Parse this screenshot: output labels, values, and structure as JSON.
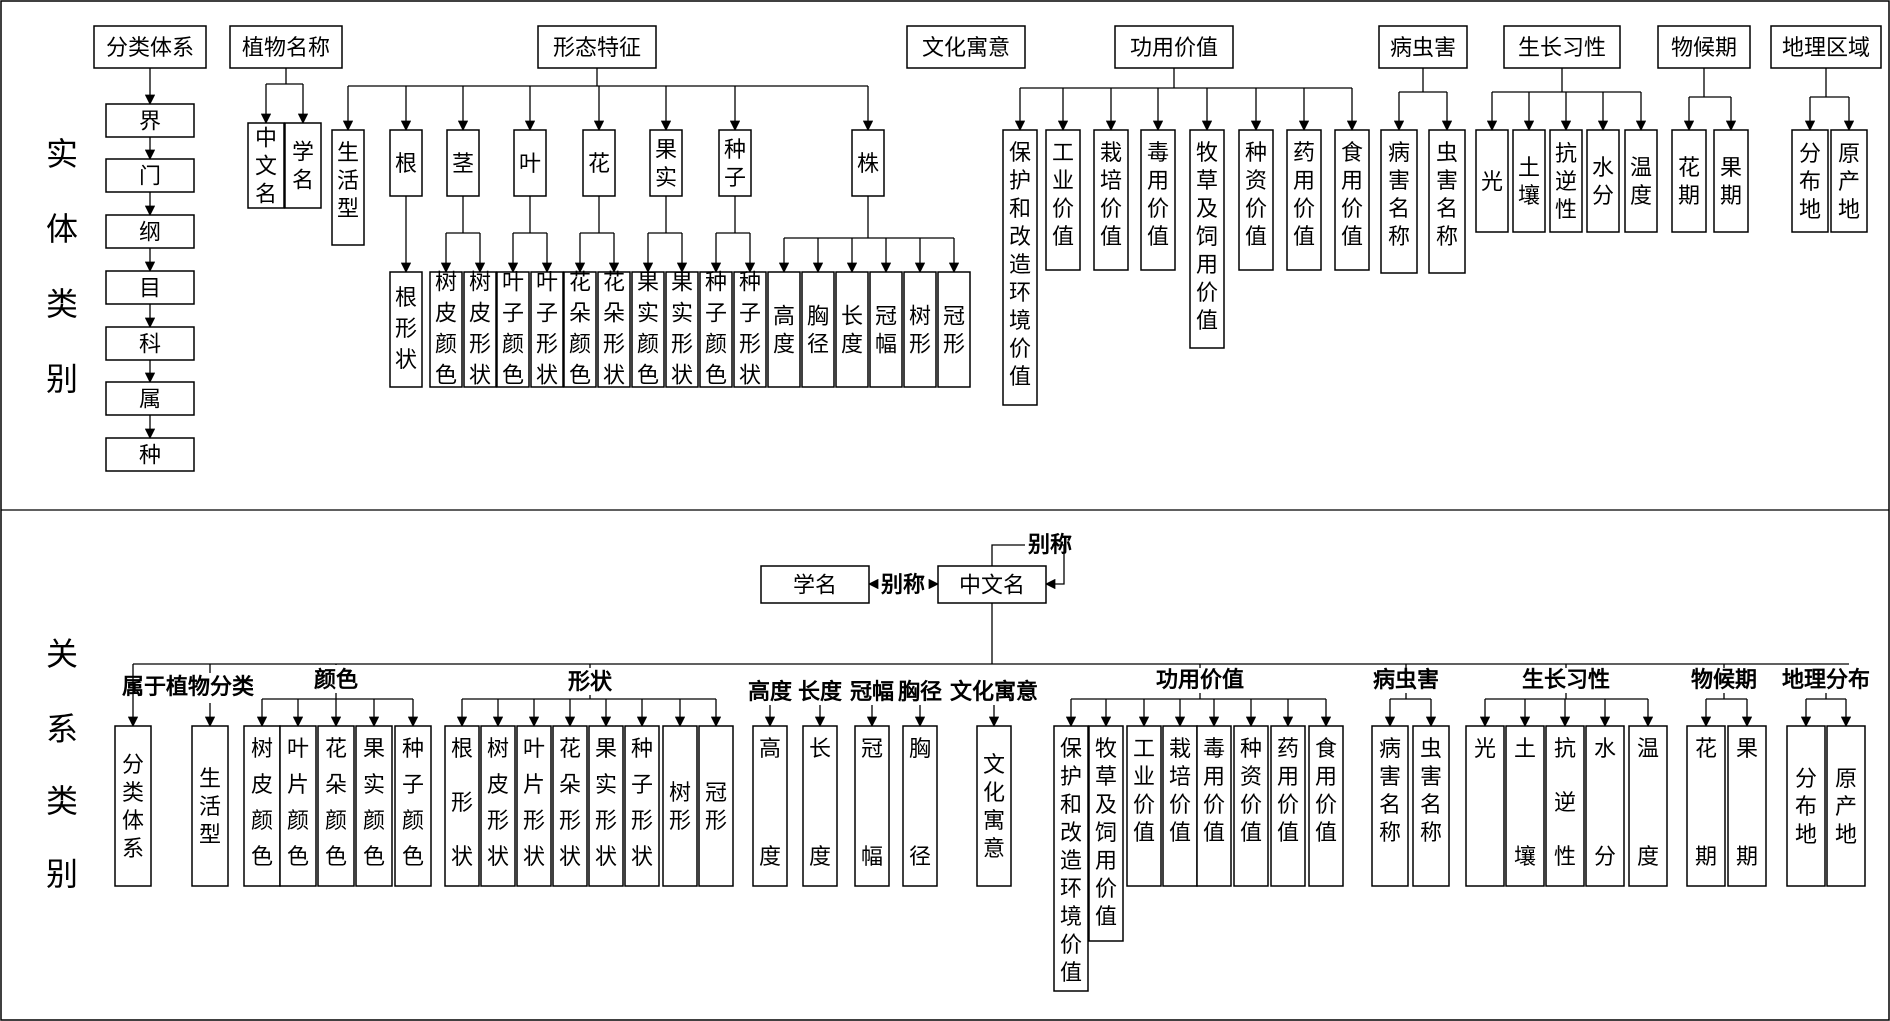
{
  "entity_section": {
    "title": "实体类别",
    "categories": {
      "taxonomy": "分类体系",
      "plant_name": "植物名称",
      "morphology": "形态特征",
      "cultural_meaning": "文化寓意",
      "value": "功用价值",
      "pests": "病虫害",
      "growth": "生长习性",
      "phenology": "物候期",
      "region": "地理区域"
    },
    "taxonomy_levels": [
      "界",
      "门",
      "纲",
      "目",
      "科",
      "属",
      "种"
    ],
    "name_children": [
      "中文名",
      "学名"
    ],
    "morph_children": [
      "生活型",
      "根",
      "茎",
      "叶",
      "花",
      "果实",
      "种子",
      "株"
    ],
    "morph_root_child": "根形状",
    "morph_pairs": [
      [
        "树皮颜色",
        "树皮形状"
      ],
      [
        "叶子颜色",
        "叶子形状"
      ],
      [
        "花朵颜色",
        "花朵形状"
      ],
      [
        "果实颜色",
        "果实形状"
      ],
      [
        "种子颜色",
        "种子形状"
      ]
    ],
    "morph_plant_children": [
      "高度",
      "胸径",
      "长度",
      "冠幅",
      "树形",
      "冠形"
    ],
    "value_children": [
      "保护和改造环境价值",
      "工业价值",
      "栽培价值",
      "毒用价值",
      "牧草及饲用价值",
      "种资价值",
      "药用价值",
      "食用价值"
    ],
    "pest_children": [
      "病害名称",
      "虫害名称"
    ],
    "growth_children": [
      "光",
      "土壤",
      "抗逆性",
      "水分",
      "温度"
    ],
    "phenology_children": [
      "花期",
      "果期"
    ],
    "region_children": [
      "分布地",
      "原产地"
    ]
  },
  "relation_section": {
    "title": "关系类别",
    "center": "中文名",
    "scientific": "学名",
    "alias_label": "别称",
    "self_alias_label": "别称",
    "relations": {
      "belongs": "属于",
      "plant_class": "植物分类",
      "color": "颜色",
      "shape": "形状",
      "height": "高度",
      "length": "长度",
      "crown": "冠幅",
      "dbh": "胸径",
      "culture": "文化寓意",
      "value": "功用价值",
      "pests": "病虫害",
      "growth": "生长习性",
      "phenology": "物候期",
      "distribution": "地理分布"
    },
    "targets": {
      "taxonomy": "分类体系",
      "life_form": "生活型",
      "colors": [
        "树皮颜色",
        "叶片颜色",
        "花朵颜色",
        "果实颜色",
        "种子颜色"
      ],
      "shapes": [
        "根形状",
        "树皮形状",
        "叶片形状",
        "花朵形状",
        "果实形状",
        "种子形状",
        "树形",
        "冠形"
      ],
      "height": "高度",
      "length": "长度",
      "crown": "冠幅",
      "dbh": "胸径",
      "culture": "文化寓意",
      "values": [
        "保护和改造环境价值",
        "牧草及饲用价值",
        "工业价值",
        "栽培价值",
        "毒用价值",
        "种资价值",
        "药用价值",
        "食用价值"
      ],
      "pests": [
        "病害名称",
        "虫害名称"
      ],
      "growth": [
        "光",
        "土壤",
        "抗逆性",
        "水分",
        "温度"
      ],
      "phenology": [
        "花期",
        "果期"
      ],
      "region": [
        "分布地",
        "原产地"
      ]
    }
  }
}
